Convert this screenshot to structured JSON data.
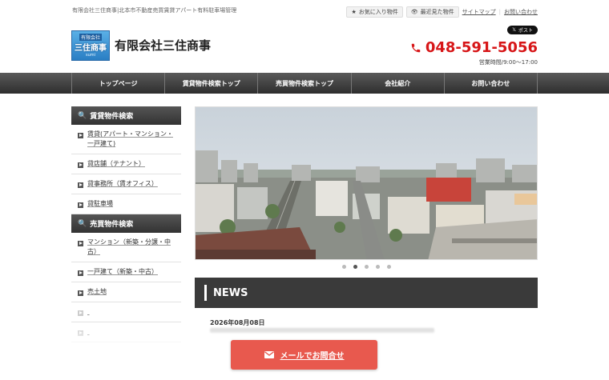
{
  "header": {
    "tagline": "有限会社三住商事|北本市不動産売買賃貸アパート有料駐車場管理",
    "favorites_label": "お気に入り物件",
    "recent_label": "最近見た物件",
    "sitemap_label": "サイトマップ",
    "contact_label": "お問い合わせ",
    "company_name": "有限会社三住商事",
    "logo": {
      "line1": "有限会社",
      "line2": "三住商事",
      "line3": "sumi"
    },
    "x_post_label": "ポスト",
    "phone": "048-591-5056",
    "hours": "営業時間/9:00～17:00"
  },
  "nav": {
    "items": [
      "トップページ",
      "賃貸物件検索トップ",
      "売買物件検索トップ",
      "会社紹介",
      "お問い合わせ"
    ]
  },
  "sidebar": {
    "rental_heading": "賃貸物件検索",
    "rental_items": [
      "賃貸(アパート・マンション・一戸建て)",
      "貸店舗（テナント）",
      "貸事務所（賃オフィス）",
      "貸駐車場"
    ],
    "sale_heading": "売買物件検索",
    "sale_items": [
      "マンション（新築・分譲・中古）",
      "一戸建て（新築・中古）",
      "売土地"
    ]
  },
  "slider": {
    "total": 5,
    "active": 2
  },
  "news": {
    "heading": "NEWS",
    "date": "2026年08月08日"
  },
  "cta": {
    "label": "メールでお問合せ"
  },
  "colors": {
    "phone": "#d71618",
    "cta": "#e8594e",
    "nav": "#3a3a3a"
  }
}
